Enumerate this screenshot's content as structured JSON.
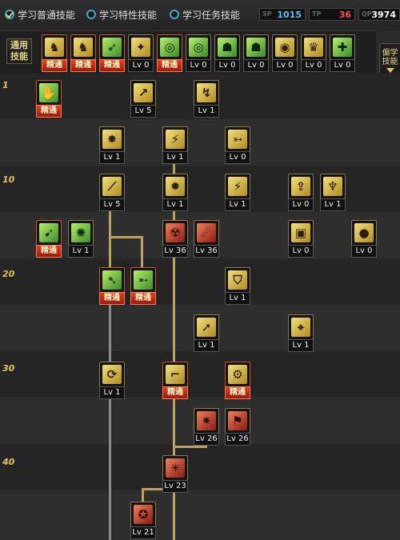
{
  "tabs": [
    {
      "label": "学习普通技能",
      "checked": true
    },
    {
      "label": "学习特性技能",
      "checked": false
    },
    {
      "label": "学习任务技能",
      "checked": false
    }
  ],
  "sp": [
    {
      "tag": "SP",
      "value": "1015",
      "color": "#4fc3f7"
    },
    {
      "tag": "TP",
      "value": "36",
      "color": "#ef5350"
    },
    {
      "tag": "QP",
      "value": "3974",
      "color": "#ffffff"
    }
  ],
  "common_label": "通用\n技能",
  "sidebar_label": "偏学\n技能",
  "level_labels": [
    "1",
    "10",
    "20",
    "30",
    "40"
  ],
  "icons": {
    "master": "精通"
  },
  "common_skills": [
    {
      "icon": "sit-rest-icon",
      "glyph": "♞",
      "color": "y",
      "caption": "精通",
      "master": true
    },
    {
      "icon": "sit-rest-icon",
      "glyph": "♞",
      "color": "y",
      "caption": "精通",
      "master": true
    },
    {
      "icon": "dash-icon",
      "glyph": "➶",
      "color": "g",
      "caption": "精通",
      "master": true
    },
    {
      "icon": "wings-icon",
      "glyph": "✦",
      "color": "y",
      "caption": "Lv 0",
      "master": false
    },
    {
      "icon": "target-icon",
      "glyph": "◎",
      "color": "g",
      "caption": "精通",
      "master": true
    },
    {
      "icon": "target-icon",
      "glyph": "◎",
      "color": "g",
      "caption": "Lv 0",
      "master": false
    },
    {
      "icon": "summon-icon",
      "glyph": "☗",
      "color": "g",
      "caption": "Lv 0",
      "master": false
    },
    {
      "icon": "summon-icon",
      "glyph": "☗",
      "color": "g",
      "caption": "Lv 0",
      "master": false
    },
    {
      "icon": "eye-icon",
      "glyph": "◉",
      "color": "y",
      "caption": "Lv 0",
      "master": false
    },
    {
      "icon": "strength-icon",
      "glyph": "♛",
      "color": "y",
      "caption": "Lv 0",
      "master": false
    },
    {
      "icon": "buff-icon",
      "glyph": "✚",
      "color": "g",
      "caption": "Lv 0",
      "master": false
    }
  ],
  "tree_skills": [
    {
      "id": "s1",
      "icon": "basic-attack-icon",
      "glyph": "✋",
      "color": "g",
      "caption": "精通",
      "master": true
    },
    {
      "id": "s2",
      "icon": "uppercut-icon",
      "glyph": "↗",
      "color": "y",
      "caption": "Lv 5",
      "master": false
    },
    {
      "id": "s3",
      "icon": "throw-icon",
      "glyph": "↯",
      "color": "y",
      "caption": "Lv 1",
      "master": false
    },
    {
      "id": "s4",
      "icon": "burst-icon",
      "glyph": "✸",
      "color": "y",
      "caption": "Lv 1",
      "master": false
    },
    {
      "id": "s5",
      "icon": "slash-icon",
      "glyph": "⚡",
      "color": "y",
      "caption": "Lv 1",
      "master": false
    },
    {
      "id": "s6",
      "icon": "gun-icon",
      "glyph": "➳",
      "color": "y",
      "caption": "Lv 0",
      "master": false
    },
    {
      "id": "s7",
      "icon": "claw-icon",
      "glyph": "⟋",
      "color": "y",
      "caption": "Lv 5",
      "master": false
    },
    {
      "id": "s8",
      "icon": "explosion-icon",
      "glyph": "✹",
      "color": "y",
      "caption": "Lv 1",
      "master": false
    },
    {
      "id": "s9",
      "icon": "spark-icon",
      "glyph": "⚡",
      "color": "y",
      "caption": "Lv 1",
      "master": false
    },
    {
      "id": "s10",
      "icon": "mark-icon",
      "glyph": "⇪",
      "color": "y",
      "caption": "Lv 0",
      "master": false
    },
    {
      "id": "s11",
      "icon": "demon-icon",
      "glyph": "♆",
      "color": "y",
      "caption": "Lv 1",
      "master": false
    },
    {
      "id": "s12",
      "icon": "archer-icon",
      "glyph": "➹",
      "color": "g",
      "caption": "精通",
      "master": true
    },
    {
      "id": "s13",
      "icon": "gatling-icon",
      "glyph": "✺",
      "color": "g",
      "caption": "Lv 1",
      "master": false
    },
    {
      "id": "s14",
      "icon": "mech-icon",
      "glyph": "☢",
      "color": "r",
      "caption": "Lv 36",
      "master": false
    },
    {
      "id": "s15",
      "icon": "flame-icon",
      "glyph": "☄",
      "color": "r",
      "caption": "Lv 36",
      "master": false
    },
    {
      "id": "s16",
      "icon": "cannon-icon",
      "glyph": "▣",
      "color": "y",
      "caption": "Lv 0",
      "master": false
    },
    {
      "id": "s17",
      "icon": "grenade-icon",
      "glyph": "●",
      "color": "y",
      "caption": "Lv 0",
      "master": false
    },
    {
      "id": "s18",
      "icon": "kick-icon",
      "glyph": "➴",
      "color": "g",
      "caption": "精通",
      "master": true
    },
    {
      "id": "s19",
      "icon": "rifle-icon",
      "glyph": "➵",
      "color": "g",
      "caption": "精通",
      "master": true
    },
    {
      "id": "s20",
      "icon": "shield-icon",
      "glyph": "⛉",
      "color": "y",
      "caption": "Lv 1",
      "master": false
    },
    {
      "id": "s21",
      "icon": "rocket-icon",
      "glyph": "➚",
      "color": "y",
      "caption": "Lv 1",
      "master": false
    },
    {
      "id": "s22",
      "icon": "sniper-icon",
      "glyph": "⌖",
      "color": "y",
      "caption": "Lv 1",
      "master": false
    },
    {
      "id": "s23",
      "icon": "spin-kick-icon",
      "glyph": "⟳",
      "color": "y",
      "caption": "Lv 1",
      "master": false
    },
    {
      "id": "s24",
      "icon": "pistol-icon",
      "glyph": "⌐",
      "color": "y",
      "caption": "精通",
      "master": true
    },
    {
      "id": "s25",
      "icon": "revolver-icon",
      "glyph": "⚙",
      "color": "y",
      "caption": "精通",
      "master": true
    },
    {
      "id": "s26",
      "icon": "barrage-icon",
      "glyph": "✷",
      "color": "r",
      "caption": "Lv 26",
      "master": false
    },
    {
      "id": "s27",
      "icon": "flamethrower-icon",
      "glyph": "⚑",
      "color": "r",
      "caption": "Lv 26",
      "master": false
    },
    {
      "id": "s28",
      "icon": "laser-icon",
      "glyph": "✳",
      "color": "r",
      "caption": "Lv 23",
      "master": false
    },
    {
      "id": "s29",
      "icon": "satellite-icon",
      "glyph": "✪",
      "color": "r",
      "caption": "Lv 21",
      "master": false
    }
  ]
}
